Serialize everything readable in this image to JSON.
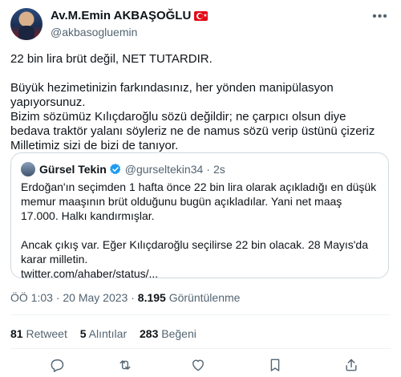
{
  "author": {
    "display_name": "Av.M.Emin AKBAŞOĞLU",
    "handle": "@akbasogluemin"
  },
  "tweet": {
    "lines": [
      "22 bin lira brüt değil, NET TUTARDIR.",
      "Büyük hezimetinizin farkındasınız, her yönden manipülasyon yapıyorsunuz.",
      "Bizim sözümüz Kılıçdaroğlu sözü değildir; ne çarpıcı olsun diye bedava traktör yalanı söyleriz ne de namus sözü verip üstünü çizeriz",
      "Milletimiz sizi de bizi de tanıyor."
    ]
  },
  "quote": {
    "display_name": "Gürsel Tekin",
    "handle": "@gurseltekin34",
    "separator": "·",
    "time": "2s",
    "text_1": "Erdoğan'ın seçimden 1 hafta önce 22 bin lira olarak açıkladığı en düşük memur maaşının brüt olduğunu bugün açıkladılar. Yani net maaş 17.000. Halkı kandırmışlar.",
    "text_2": "Ancak çıkış var. Eğer Kılıçdaroğlu seçilirse 22 bin olacak. 28 Mayıs'da karar milletin.",
    "link": "twitter.com/ahaber/status/..."
  },
  "meta": {
    "time": "ÖÖ 1:03",
    "date": "20 May 2023",
    "views_count": "8.195",
    "views_label": "Görüntülenme"
  },
  "stats": {
    "retweets_count": "81",
    "retweets_label": "Retweet",
    "quotes_count": "5",
    "quotes_label": "Alıntılar",
    "likes_count": "283",
    "likes_label": "Beğeni"
  },
  "icons": {
    "more": "more-icon",
    "verified": "verified-badge-icon",
    "reply": "reply-icon",
    "retweet": "retweet-icon",
    "like": "like-icon",
    "bookmark": "bookmark-icon",
    "share": "share-icon"
  },
  "colors": {
    "verified": "#1d9bf0",
    "secondary_text": "#536471",
    "flag": "#e30a17"
  }
}
